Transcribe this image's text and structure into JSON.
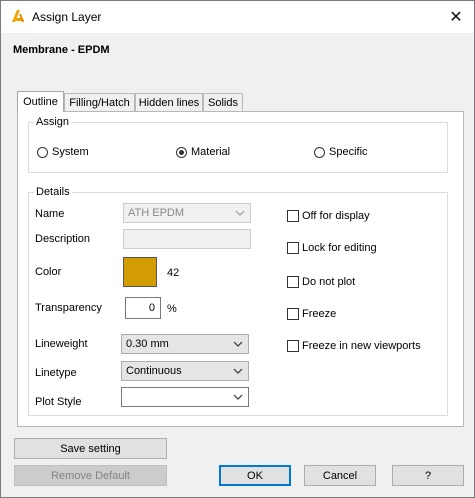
{
  "window": {
    "title": "Assign Layer",
    "close_glyph": "✕",
    "icon": "app-logo-icon",
    "header": "Membrane - EPDM"
  },
  "tabs": [
    {
      "label": "Outline",
      "active": true
    },
    {
      "label": "Filling/Hatch",
      "active": false
    },
    {
      "label": "Hidden lines",
      "active": false
    },
    {
      "label": "Solids",
      "active": false
    }
  ],
  "assign": {
    "title": "Assign",
    "options": [
      {
        "label": "System",
        "selected": false
      },
      {
        "label": "Material",
        "selected": true
      },
      {
        "label": "Specific",
        "selected": false
      }
    ]
  },
  "details": {
    "title": "Details",
    "name_label": "Name",
    "name_value": "ATH EPDM",
    "description_label": "Description",
    "description_value": "",
    "color_label": "Color",
    "color_hex": "#d39c00",
    "color_index": "42",
    "transparency_label": "Transparency",
    "transparency_value": "0",
    "transparency_unit": "%",
    "lineweight_label": "Lineweight",
    "lineweight_value": "0.30 mm",
    "linetype_label": "Linetype",
    "linetype_value": "Continuous",
    "plotstyle_label": "Plot Style",
    "plotstyle_value": ""
  },
  "checkboxes": [
    {
      "label": "Off for display",
      "checked": false
    },
    {
      "label": "Lock for editing",
      "checked": false
    },
    {
      "label": "Do not plot",
      "checked": false
    },
    {
      "label": "Freeze",
      "checked": false
    },
    {
      "label": "Freeze in new viewports",
      "checked": false
    }
  ],
  "buttons": {
    "save": "Save setting",
    "remove": "Remove Default",
    "ok": "OK",
    "cancel": "Cancel",
    "help": "?"
  },
  "colors": {
    "accent": "#0078d7",
    "icon_orange": "#f5a100"
  }
}
